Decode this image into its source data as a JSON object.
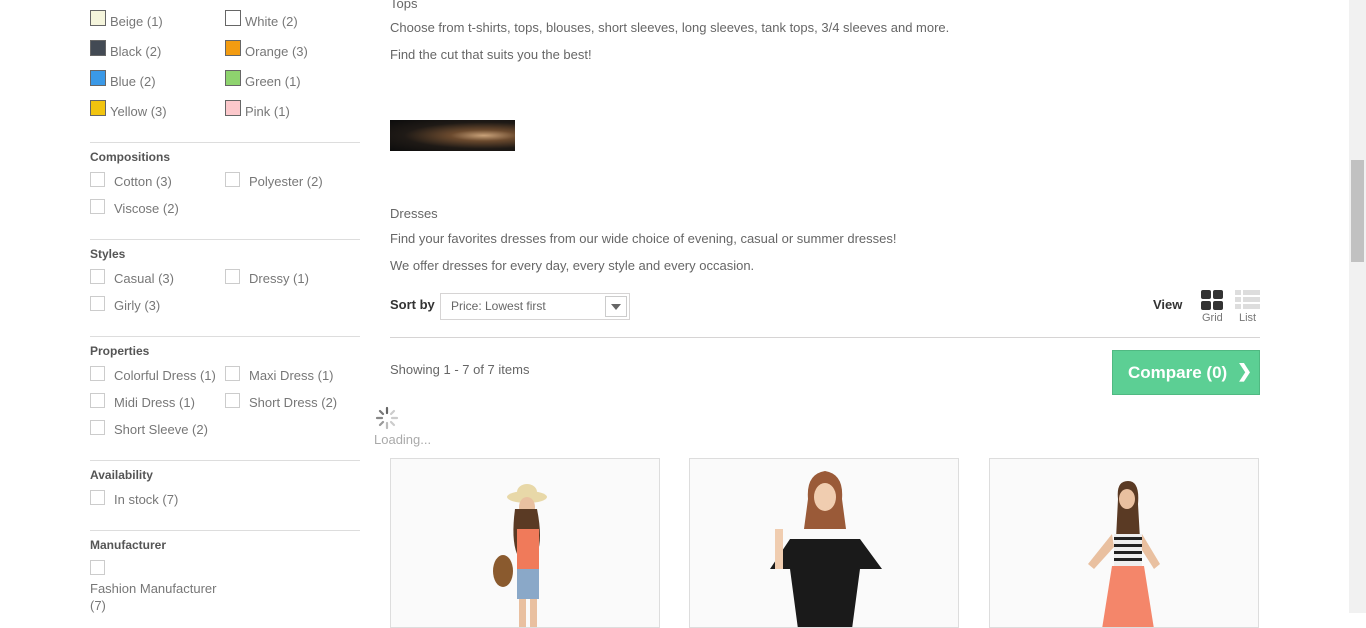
{
  "sidebar": {
    "colors": [
      {
        "label": "Beige (1)",
        "color": "#f5f5dc"
      },
      {
        "label": "White (2)",
        "color": "#ffffff"
      },
      {
        "label": "Black (2)",
        "color": "#434a54"
      },
      {
        "label": "Orange (3)",
        "color": "#f39c11"
      },
      {
        "label": "Blue (2)",
        "color": "#3a99e7"
      },
      {
        "label": "Green (1)",
        "color": "#8ed36e"
      },
      {
        "label": "Yellow (3)",
        "color": "#f1c40f"
      },
      {
        "label": "Pink (1)",
        "color": "#fcc8cb"
      }
    ],
    "compositions": {
      "title": "Compositions",
      "items": [
        "Cotton (3)",
        "Polyester (2)",
        "Viscose (2)"
      ]
    },
    "styles": {
      "title": "Styles",
      "items": [
        "Casual (3)",
        "Dressy (1)",
        "Girly (3)"
      ]
    },
    "properties": {
      "title": "Properties",
      "items": [
        "Colorful Dress (1)",
        "Maxi Dress (1)",
        "Midi Dress (1)",
        "Short Dress (2)",
        "Short Sleeve (2)"
      ]
    },
    "availability": {
      "title": "Availability",
      "items": [
        "In stock (7)"
      ]
    },
    "manufacturer": {
      "title": "Manufacturer",
      "items": [
        "Fashion Manufacturer",
        "(7)"
      ]
    }
  },
  "main": {
    "tops_title": "Tops",
    "tops_desc1": "Choose from t-shirts, tops, blouses, short sleeves, long sleeves, tank tops, 3/4 sleeves and more.",
    "tops_desc2": "Find the cut that suits you the best!",
    "dresses_title": "Dresses",
    "dresses_desc1": "Find your favorites dresses from our wide choice of evening, casual or summer dresses!",
    "dresses_desc2": "We offer dresses for every day, every style and every occasion.",
    "sort_label": "Sort by",
    "sort_value": "Price: Lowest first",
    "view_label": "View",
    "grid_label": "Grid",
    "list_label": "List",
    "showing": "Showing 1 - 7 of 7 items",
    "compare": "Compare (0)",
    "loading": "Loading..."
  }
}
